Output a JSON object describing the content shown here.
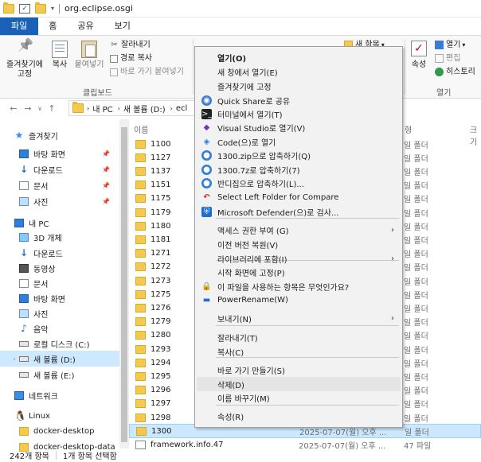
{
  "window": {
    "title": "org.eclipse.osgi"
  },
  "ribbon_tabs": [
    "파일",
    "홈",
    "공유",
    "보기"
  ],
  "ribbon": {
    "pin_label": "즐겨찾기에\n고정",
    "copy_label": "복사",
    "paste_label": "붙여넣기",
    "cut_label": "잘라내기",
    "copy_path_label": "경로 복사",
    "paste_shortcut_label": "바로 가기 붙여넣기",
    "clipboard_group": "클립보드",
    "new_label": "새 항목",
    "properties_label": "속성",
    "open_label": "열기",
    "edit_label": "편집",
    "history_label": "히스토리",
    "open_group": "열기"
  },
  "address": {
    "segments": [
      "내 PC",
      "새 볼륨 (D:)",
      "ecl"
    ]
  },
  "nav": {
    "items": [
      {
        "label": "즐겨찾기",
        "icon": "star-icon"
      },
      {
        "label": "바탕 화면",
        "icon": "desktop-icon",
        "pinned": true
      },
      {
        "label": "다운로드",
        "icon": "download-icon",
        "pinned": true
      },
      {
        "label": "문서",
        "icon": "document-icon",
        "pinned": true
      },
      {
        "label": "사진",
        "icon": "pictures-icon",
        "pinned": true
      },
      {
        "label": "내 PC",
        "icon": "pc-icon"
      },
      {
        "label": "3D 개체",
        "icon": "3d-objects-icon"
      },
      {
        "label": "다운로드",
        "icon": "download-icon"
      },
      {
        "label": "동영상",
        "icon": "videos-icon"
      },
      {
        "label": "문서",
        "icon": "document-icon"
      },
      {
        "label": "바탕 화면",
        "icon": "desktop-icon"
      },
      {
        "label": "사진",
        "icon": "pictures-icon"
      },
      {
        "label": "음악",
        "icon": "music-icon"
      },
      {
        "label": "로컬 디스크 (C:)",
        "icon": "drive-icon"
      },
      {
        "label": "새 볼륨 (D:)",
        "icon": "drive-icon",
        "selected": true
      },
      {
        "label": "새 볼륨 (E:)",
        "icon": "drive-icon"
      },
      {
        "label": "네트워크",
        "icon": "network-icon"
      },
      {
        "label": "Linux",
        "icon": "linux-icon"
      },
      {
        "label": "docker-desktop",
        "icon": "folder-icon"
      },
      {
        "label": "docker-desktop-data",
        "icon": "folder-icon"
      }
    ]
  },
  "columns": {
    "name": "이름",
    "type_partial": "형",
    "size_partial": "크기"
  },
  "files": [
    {
      "name": "1100",
      "type": "일 폴더"
    },
    {
      "name": "1127",
      "type": "일 폴더"
    },
    {
      "name": "1137",
      "type": "일 폴더"
    },
    {
      "name": "1151",
      "type": "일 폴더"
    },
    {
      "name": "1175",
      "type": "일 폴더"
    },
    {
      "name": "1179",
      "type": "일 폴더"
    },
    {
      "name": "1180",
      "type": "일 폴더"
    },
    {
      "name": "1181",
      "type": "일 폴더"
    },
    {
      "name": "1271",
      "type": "일 폴더"
    },
    {
      "name": "1272",
      "type": "일 폴더"
    },
    {
      "name": "1273",
      "type": "일 폴더"
    },
    {
      "name": "1275",
      "type": "일 폴더"
    },
    {
      "name": "1276",
      "type": "일 폴더"
    },
    {
      "name": "1279",
      "type": "일 폴더"
    },
    {
      "name": "1280",
      "type": "일 폴더"
    },
    {
      "name": "1293",
      "type": "일 폴더"
    },
    {
      "name": "1294",
      "type": "일 폴더"
    },
    {
      "name": "1295",
      "type": "일 폴더"
    },
    {
      "name": "1296",
      "type": "일 폴더"
    },
    {
      "name": "1297",
      "type": "일 폴더"
    },
    {
      "name": "1298",
      "type": "일 폴더"
    },
    {
      "name": "1300",
      "type": "일 폴더",
      "date": "2025-07-07(월) 오후 ...",
      "selected": true
    },
    {
      "name": "framework.info.47",
      "type": "47 파일",
      "date": "2025-07-07(월) 오후 ...",
      "file": true
    }
  ],
  "status": {
    "count": "242개 항목",
    "selected": "1개 항목 선택함"
  },
  "context_menu": {
    "items": [
      {
        "label": "열기(O)",
        "bold": true
      },
      {
        "label": "새 창에서 열기(E)"
      },
      {
        "label": "즐겨찾기에 고정"
      },
      {
        "label": "Quick Share로 공유",
        "icon": "quick-share-icon"
      },
      {
        "label": "터미널에서 열기(T)",
        "icon": "terminal-icon"
      },
      {
        "label": "Visual Studio로 열기(V)",
        "icon": "visual-studio-icon"
      },
      {
        "label": "Code(으)로 열기",
        "icon": "vscode-icon"
      },
      {
        "label": "1300.zip으로 압축하기(Q)",
        "icon": "bandizip-icon"
      },
      {
        "label": "1300.7z로 압축하기(7)",
        "icon": "bandizip-icon"
      },
      {
        "label": "반디집으로 압축하기(L)...",
        "icon": "bandizip-icon"
      },
      {
        "label": "Select Left Folder for Compare",
        "icon": "compare-icon"
      },
      {
        "label": "Microsoft Defender(으)로 검사...",
        "icon": "defender-icon"
      },
      {
        "label": "액세스 권한 부여 (G)",
        "submenu": true
      },
      {
        "label": "이전 버전 복원(V)"
      },
      {
        "label": "라이브러리에 포함(I)",
        "submenu": true
      },
      {
        "label": "시작 화면에 고정(P)"
      },
      {
        "label": "이 파일을 사용하는 항목은 무엇인가요?",
        "icon": "lock-icon"
      },
      {
        "label": "PowerRename(W)",
        "icon": "powerrename-icon"
      },
      {
        "label": "보내기(N)",
        "submenu": true
      },
      {
        "label": "잘라내기(T)"
      },
      {
        "label": "복사(C)"
      },
      {
        "label": "바로 가기 만들기(S)"
      },
      {
        "label": "삭제(D)",
        "hover": true
      },
      {
        "label": "이름 바꾸기(M)"
      },
      {
        "label": "속성(R)"
      }
    ]
  }
}
